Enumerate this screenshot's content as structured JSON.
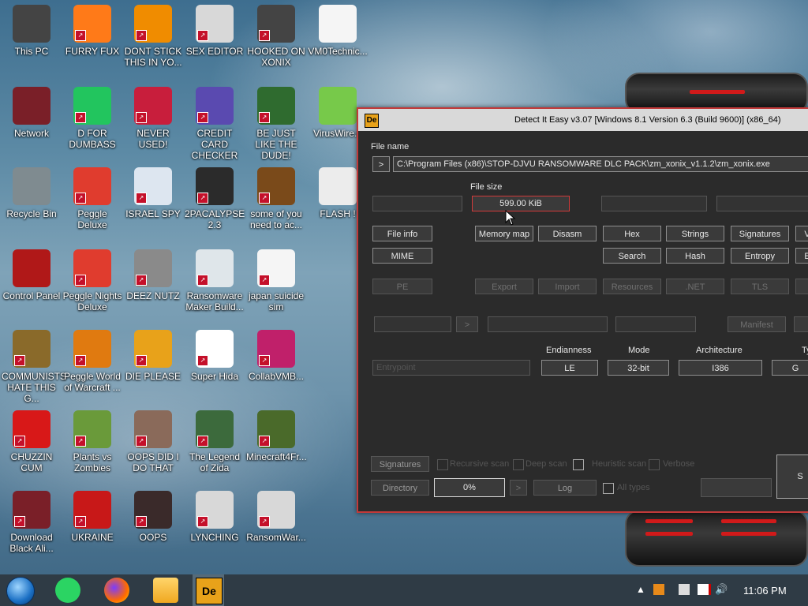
{
  "desktop": {
    "icons": [
      {
        "label": "This PC"
      },
      {
        "label": "FURRY FUX"
      },
      {
        "label": "DONT STICK THIS IN YO..."
      },
      {
        "label": "SEX EDITOR"
      },
      {
        "label": "HOOKED ON XONIX"
      },
      {
        "label": "VM0Technic..."
      },
      {
        "label": "Network"
      },
      {
        "label": "D FOR DUMBASS"
      },
      {
        "label": "NEVER USED!"
      },
      {
        "label": "CREDIT CARD CHECKER"
      },
      {
        "label": "BE JUST LIKE THE DUDE!"
      },
      {
        "label": "VirusWire.e"
      },
      {
        "label": "Recycle Bin"
      },
      {
        "label": "Peggle Deluxe"
      },
      {
        "label": "ISRAEL SPY"
      },
      {
        "label": "2PACALYPSE 2.3"
      },
      {
        "label": "some of you need to ac..."
      },
      {
        "label": "FLASH !"
      },
      {
        "label": "Control Panel"
      },
      {
        "label": "Peggle Nights Deluxe"
      },
      {
        "label": "DEEZ NUTZ"
      },
      {
        "label": "Ransomware Maker Build..."
      },
      {
        "label": "japan suicide sim"
      },
      {
        "label": "COMMUNISTS HATE THIS G..."
      },
      {
        "label": "Peggle World of Warcraft ..."
      },
      {
        "label": "DIE PLEASE"
      },
      {
        "label": "Super Hida"
      },
      {
        "label": "CollabVMB..."
      },
      {
        "label": "CHUZZIN CUM"
      },
      {
        "label": "Plants vs Zombies"
      },
      {
        "label": "OOPS DID I DO THAT"
      },
      {
        "label": "The Legend of Zida"
      },
      {
        "label": "Minecraft4Fr..."
      },
      {
        "label": "Download Black Ali..."
      },
      {
        "label": "UKRAINE"
      },
      {
        "label": "OOPS"
      },
      {
        "label": "LYNCHING"
      },
      {
        "label": "RansomWar..."
      }
    ]
  },
  "window": {
    "title": "Detect It Easy v3.07 [Windows 8.1 Version 6.3 (Build 9600)] (x86_64)",
    "icon_text": "De",
    "file_name_label": "File name",
    "file_path": "C:\\Program Files (x86)\\STOP-DJVU RANSOMWARE DLC PACK\\zm_xonix_v1.1.2\\zm_xonix.exe",
    "browse_button": ">",
    "file_size_label": "File size",
    "file_size_value": "599.00 KiB",
    "buttons_row1": {
      "file_info": "File info",
      "memory_map": "Memory map",
      "disasm": "Disasm",
      "hex": "Hex",
      "strings": "Strings",
      "signatures": "Signatures",
      "cut": "V"
    },
    "buttons_row2": {
      "mime": "MIME",
      "search": "Search",
      "hash": "Hash",
      "entropy": "Entropy",
      "cut": "E"
    },
    "buttons_row3": {
      "pe": "PE",
      "export": "Export",
      "import": "Import",
      "resources": "Resources",
      "net": ".NET",
      "tls": "TLS"
    },
    "manifest_button": "Manifest",
    "arrow_button": ">",
    "entry_point_placeholder": "Entrypoint",
    "endianness_label": "Endianness",
    "endianness_value": "LE",
    "mode_label": "Mode",
    "mode_value": "32-bit",
    "architecture_label": "Architecture",
    "architecture_value": "I386",
    "type_label": "Ty",
    "type_value": "G",
    "signatures_button": "Signatures",
    "directory_button": "Directory",
    "progress_value": "0%",
    "log_button": "Log",
    "opt_recursive": "Recursive scan",
    "opt_deep": "Deep scan",
    "opt_heuristic": "Heuristic scan",
    "opt_verbose": "Verbose",
    "opt_all_types": "All types",
    "scan_button": "S"
  },
  "taskbar": {
    "clock": "11:06 PM"
  }
}
